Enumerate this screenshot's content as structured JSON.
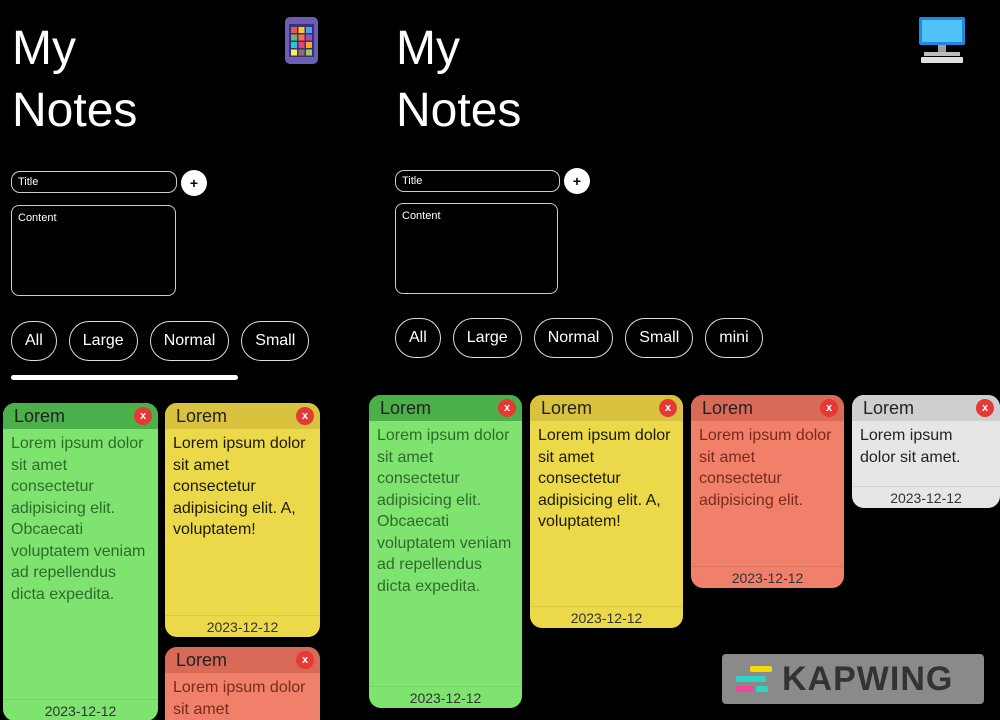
{
  "app": {
    "title_line1": "My",
    "title_line2": "Notes",
    "title_placeholder": "Title",
    "content_placeholder": "Content",
    "add_label": "+"
  },
  "left_panel": {
    "device_icon": "tablet-icon",
    "filters": [
      "All",
      "Large",
      "Normal",
      "Small"
    ],
    "notes": [
      {
        "title": "Lorem",
        "body": "Lorem ipsum dolor sit amet consectetur adipisicing elit. Obcaecati voluptatem veniam ad repellendus dicta expedita.",
        "date": "2023-12-12",
        "color": "#7ee36f"
      },
      {
        "title": "Lorem",
        "body": "Lorem ipsum dolor sit amet consectetur adipisicing elit. A, voluptatem!",
        "date": "2023-12-12",
        "color": "#ecd94a"
      },
      {
        "title": "Lorem",
        "body": "Lorem ipsum dolor sit amet",
        "date": "",
        "color": "#f0806a"
      }
    ]
  },
  "right_panel": {
    "device_icon": "desktop-icon",
    "filters": [
      "All",
      "Large",
      "Normal",
      "Small",
      "mini"
    ],
    "notes": [
      {
        "title": "Lorem",
        "body": "Lorem ipsum dolor sit amet consectetur adipisicing elit. Obcaecati voluptatem veniam ad repellendus dicta expedita.",
        "date": "2023-12-12",
        "color": "#7ee36f"
      },
      {
        "title": "Lorem",
        "body": "Lorem ipsum dolor sit amet consectetur adipisicing elit. A, voluptatem!",
        "date": "2023-12-12",
        "color": "#ecd94a"
      },
      {
        "title": "Lorem",
        "body": "Lorem ipsum dolor sit amet consectetur adipisicing elit.",
        "date": "2023-12-12",
        "color": "#f0806a"
      },
      {
        "title": "Lorem",
        "body": "Lorem ipsum dolor sit amet.",
        "date": "2023-12-12",
        "color": "#e6e6e6"
      }
    ]
  },
  "close_label": "x",
  "watermark": {
    "text": "KAPWING",
    "icon": "kapwing-logo-icon"
  }
}
